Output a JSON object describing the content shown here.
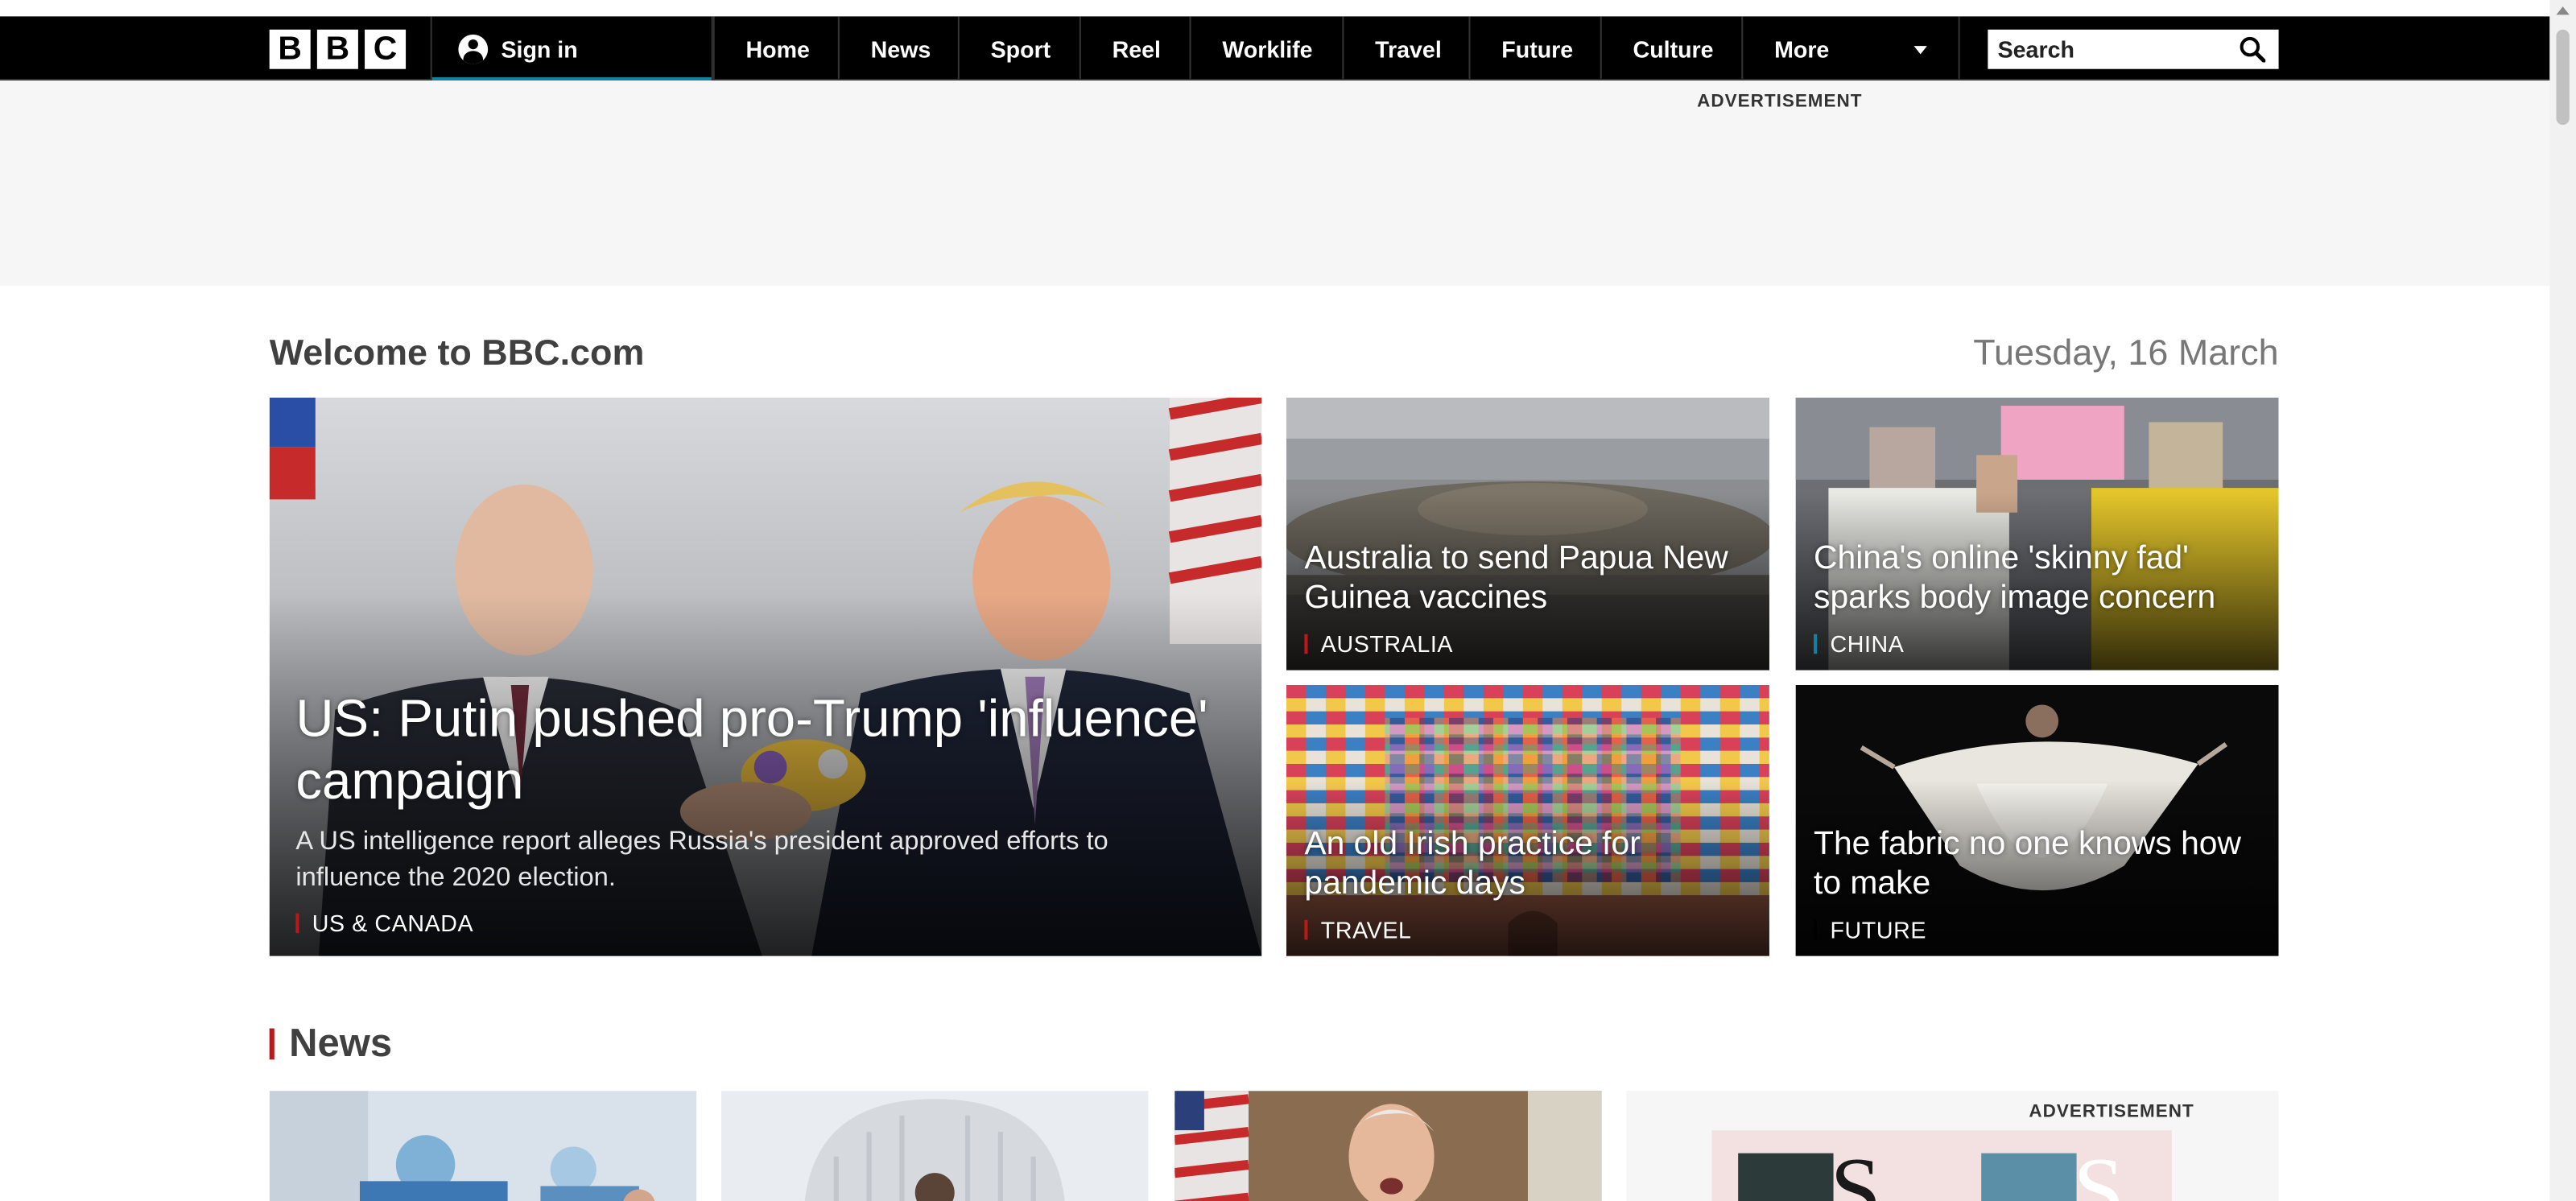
{
  "header": {
    "logo_letters": [
      "B",
      "B",
      "C"
    ],
    "sign_in_label": "Sign in",
    "nav_items": [
      {
        "label": "Home"
      },
      {
        "label": "News"
      },
      {
        "label": "Sport"
      },
      {
        "label": "Reel"
      },
      {
        "label": "Worklife"
      },
      {
        "label": "Travel"
      },
      {
        "label": "Future"
      },
      {
        "label": "Culture"
      },
      {
        "label": "More"
      }
    ],
    "search_placeholder": "Search"
  },
  "ad_top": {
    "label": "ADVERTISEMENT"
  },
  "welcome": {
    "title": "Welcome to BBC.com",
    "date": "Tuesday, 16 March"
  },
  "hero": {
    "headline": "US: Putin pushed pro-Trump 'influence' campaign",
    "summary": "A US intelligence report alleges Russia's president approved efforts to influence the 2020 election.",
    "tag": "US & CANADA"
  },
  "stories": [
    {
      "headline": "Australia to send Papua New Guinea vaccines",
      "tag": "AUSTRALIA",
      "tag_color": "#bb1919"
    },
    {
      "headline": "China's online 'skinny fad' sparks body image concern",
      "tag": "CHINA",
      "tag_color": "#1380a1"
    },
    {
      "headline": "An old Irish practice for pandemic days",
      "tag": "TRAVEL",
      "tag_color": "#bb1919"
    },
    {
      "headline": "The fabric no one knows how to make",
      "tag": "FUTURE",
      "tag_color": "#000000"
    }
  ],
  "news_section": {
    "title": "News",
    "ad_label": "ADVERTISEMENT"
  },
  "colors": {
    "brand_black": "#000000",
    "news_red": "#bb1919",
    "signin_underline": "#1380a1",
    "ad_background": "#f6f6f6"
  }
}
